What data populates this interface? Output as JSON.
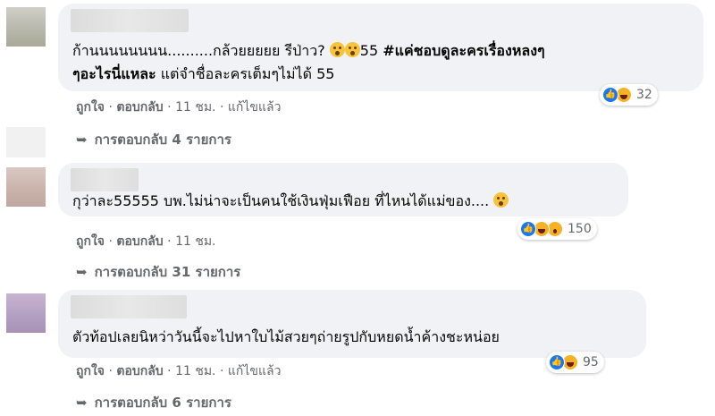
{
  "comments": [
    {
      "text_part1": "ก้านนนนนนนน..........กล้วยยยยย รีป่าว?",
      "text_part2": "55",
      "hashtag_line1": "#แค่ชอบดูละครเรื่องหลงๆ",
      "hashtag_line2": "ๆอะไรนี่แหละ",
      "text_line2": "แต่จำชื่อละครเต็มๆไม่ได้ 55",
      "reaction_count": "32",
      "like": "ถูกใจ",
      "reply": "ตอบกลับ",
      "time": "11 ชม.",
      "edited": "แก้ไขแล้ว",
      "replies_label": "การตอบกลับ 4 รายการ"
    },
    {
      "text": "กุว่าละ55555 บพ.ไม่น่าจะเป็นคนใช้เงินฟุ่มเฟือย ที่ไหนได้แม่ของ....",
      "reaction_count": "150",
      "like": "ถูกใจ",
      "reply": "ตอบกลับ",
      "time": "11 ชม.",
      "replies_label": "การตอบกลับ 31 รายการ"
    },
    {
      "text": "ตัวท้อปเลยนิหว่าวันนี้จะไปหาใบไม้สวยๆถ่ายรูปกับหยดน้ำค้างชะหน่อย",
      "reaction_count": "95",
      "like": "ถูกใจ",
      "reply": "ตอบกลับ",
      "time": "11 ชม.",
      "edited": "แก้ไขแล้ว",
      "replies_label": "การตอบกลับ 6 รายการ"
    }
  ],
  "separators": {
    "dot": "·",
    "like_icon": "👍",
    "reply_arrow": "➥"
  }
}
